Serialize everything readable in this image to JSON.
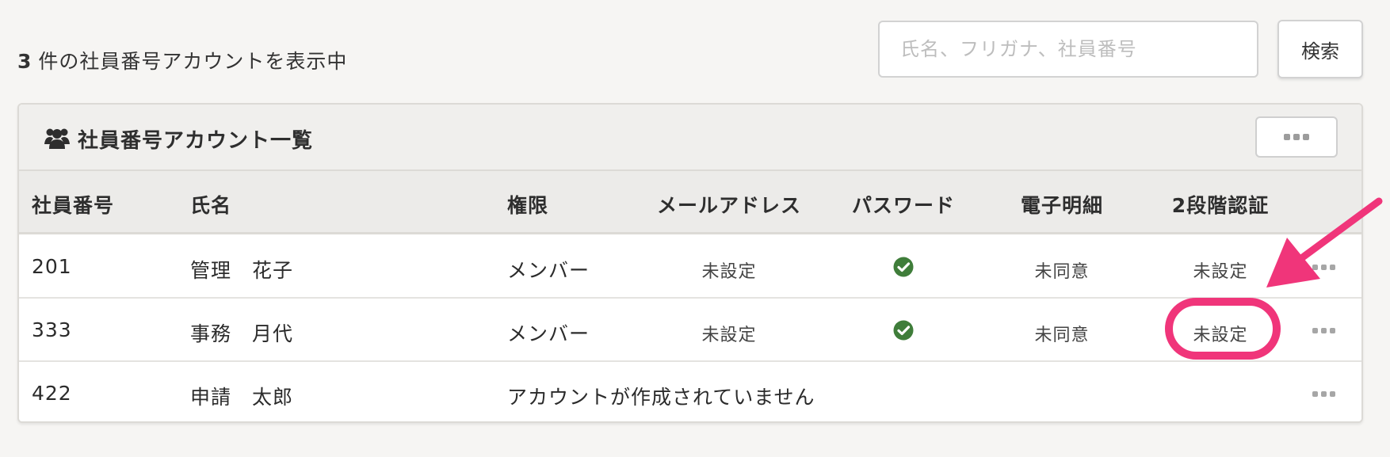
{
  "summary": {
    "count": "3",
    "text": "件の社員番号アカウントを表示中"
  },
  "search": {
    "placeholder": "氏名、フリガナ、社員番号",
    "button_label": "検索"
  },
  "card": {
    "title": "社員番号アカウント一覧",
    "icon": "users-icon"
  },
  "table": {
    "headers": {
      "id": "社員番号",
      "name": "氏名",
      "role": "権限",
      "email": "メールアドレス",
      "password": "パスワード",
      "e_statement": "電子明細",
      "two_factor": "2段階認証"
    },
    "rows": [
      {
        "id": "201",
        "name": "管理　花子",
        "role": "メンバー",
        "email": "未設定",
        "password": "check-circle-icon",
        "e_statement": "未同意",
        "two_factor": "未設定"
      },
      {
        "id": "333",
        "name": "事務　月代",
        "role": "メンバー",
        "email": "未設定",
        "password": "check-circle-icon",
        "e_statement": "未同意",
        "two_factor": "未設定"
      },
      {
        "id": "422",
        "name": "申請　太郎",
        "no_account": "アカウントが作成されていません"
      }
    ]
  },
  "colors": {
    "check": "#3f7d3a",
    "highlight": "#f0357a",
    "background": "#f6f5f3",
    "header_bg": "#ecebe9"
  }
}
